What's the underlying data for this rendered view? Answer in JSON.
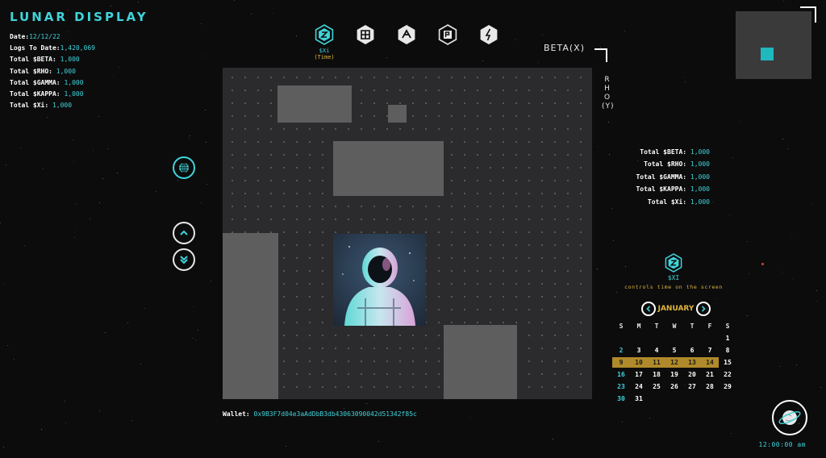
{
  "app": {
    "title": "LUNAR DISPLAY"
  },
  "stats_left": [
    {
      "label": "Date:",
      "value": "12/12/22"
    },
    {
      "label": "Logs To Date:",
      "value": "1,420,069"
    },
    {
      "label": "Total $BETA: ",
      "value": "1,000"
    },
    {
      "label": "Total $RHO: ",
      "value": "1,000"
    },
    {
      "label": "Total $GAMMA: ",
      "value": "1,000"
    },
    {
      "label": "Total $KAPPA: ",
      "value": "1,000"
    },
    {
      "label": "Total $Xi: ",
      "value": "1,000"
    }
  ],
  "tokens": [
    {
      "name": "xi-token-icon",
      "label": "$Xi",
      "sub": "(Time)"
    },
    {
      "name": "kappa-token-icon",
      "label": "",
      "sub": ""
    },
    {
      "name": "gamma-token-icon",
      "label": "",
      "sub": ""
    },
    {
      "name": "rho-token-icon",
      "label": "",
      "sub": ""
    },
    {
      "name": "beta-token-icon",
      "label": "",
      "sub": ""
    }
  ],
  "axes": {
    "x_label": "BETA(X)",
    "y_label": [
      "R",
      "H",
      "O",
      "(Y)"
    ]
  },
  "stats_right": [
    {
      "label": "Total $BETA: ",
      "value": "1,000"
    },
    {
      "label": "Total $RHO: ",
      "value": "1,000"
    },
    {
      "label": "Total $GAMMA: ",
      "value": "1,000"
    },
    {
      "label": "Total $KAPPA: ",
      "value": "1,000"
    },
    {
      "label": "Total $Xi: ",
      "value": "1,000"
    }
  ],
  "wallet": {
    "label": "Wallet: ",
    "address": "0x9B3F7d04e3aAdDbB3db43063090042d51342f85c"
  },
  "controls": {
    "globe_icon": "globe-icon",
    "up_icon": "chevron-up-icon",
    "down_icon": "double-chevron-down-icon"
  },
  "time_panel": {
    "label": "$XI",
    "description": "controls time on the screen"
  },
  "calendar": {
    "month": "JANUARY",
    "days_of_week": [
      "S",
      "M",
      "T",
      "W",
      "T",
      "F",
      "S"
    ],
    "weeks": [
      [
        "",
        "",
        "",
        "",
        "",
        "",
        "1"
      ],
      [
        "2",
        "3",
        "4",
        "5",
        "6",
        "7",
        "8"
      ],
      [
        "9",
        "10",
        "11",
        "12",
        "13",
        "14",
        "15"
      ],
      [
        "16",
        "17",
        "18",
        "19",
        "20",
        "21",
        "22"
      ],
      [
        "23",
        "24",
        "25",
        "26",
        "27",
        "28",
        "29"
      ],
      [
        "30",
        "31",
        "",
        "",
        "",
        "",
        ""
      ]
    ],
    "highlighted_days": [
      "9",
      "10",
      "11",
      "12",
      "13",
      "14"
    ],
    "highlight_color": "#b08a2a"
  },
  "clock": {
    "time": "12:00:00 am"
  },
  "colors": {
    "accent": "#3fd4d9",
    "gold": "#e0b53a",
    "background": "#0c0c0d",
    "grid": "#2b2b2d",
    "block": "#5e5e5f"
  }
}
